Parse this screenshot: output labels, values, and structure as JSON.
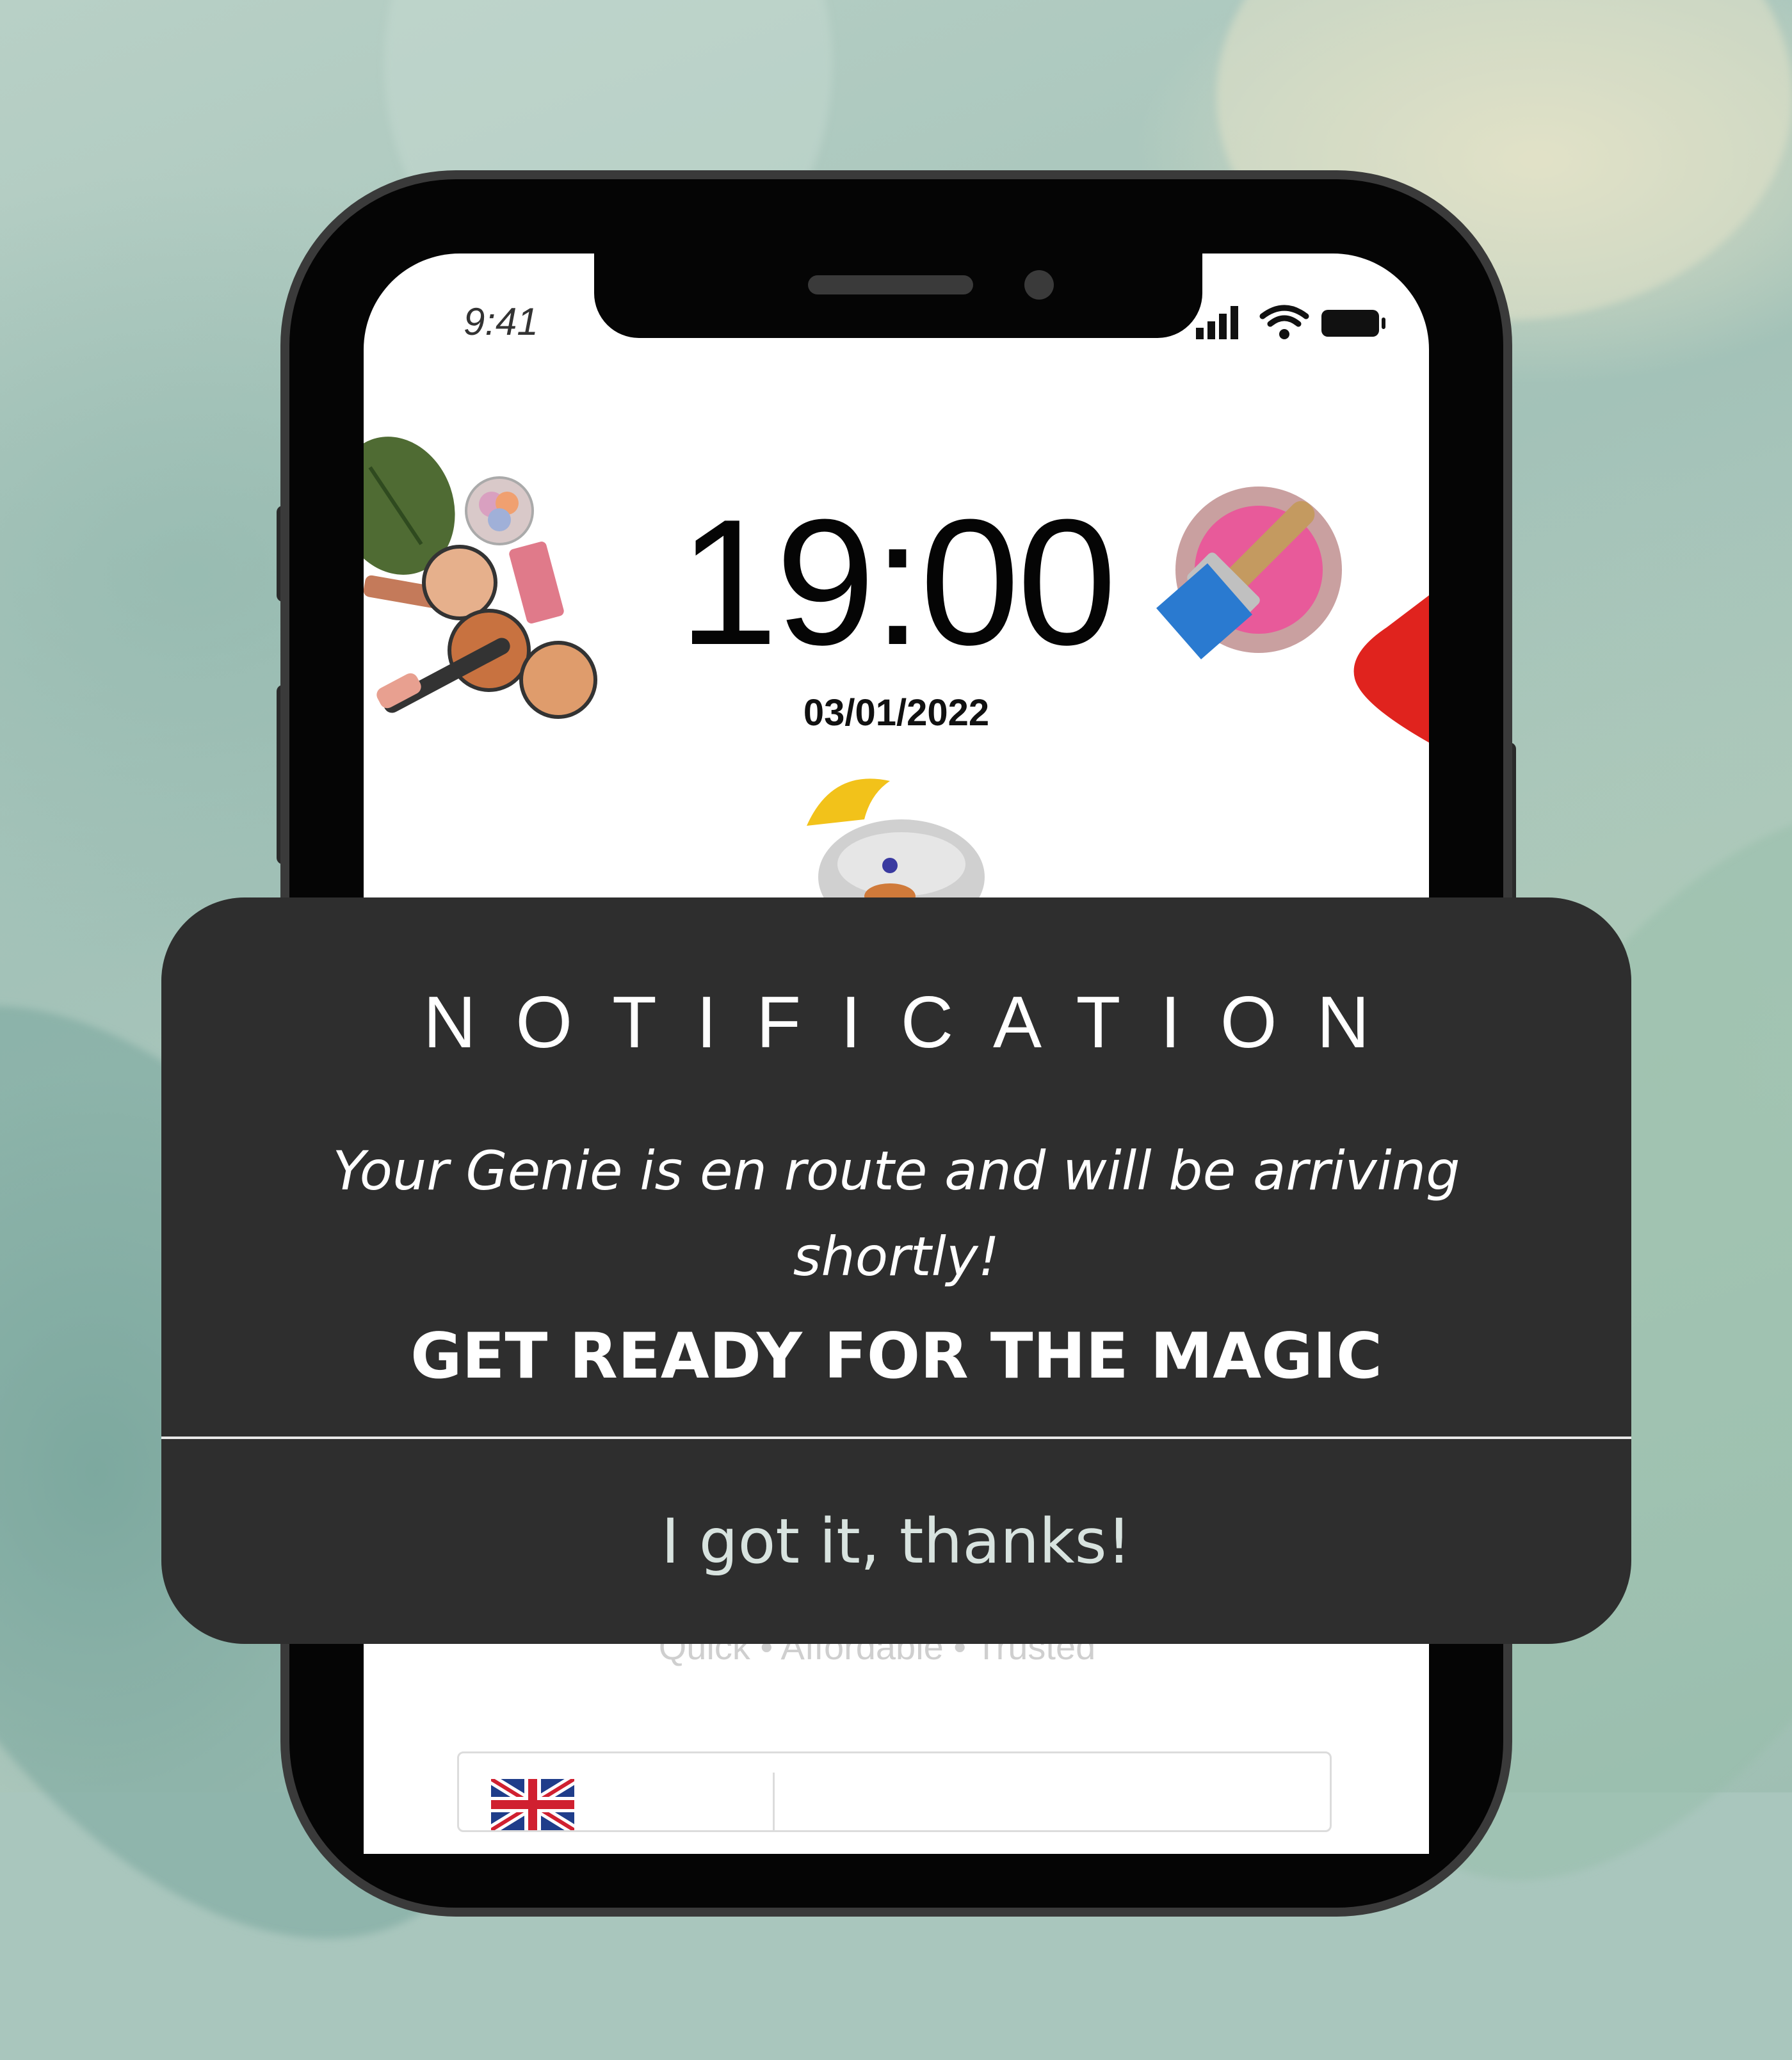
{
  "status_bar": {
    "time": "9:41"
  },
  "lock_screen": {
    "clock": "19:00",
    "date": "03/01/2022"
  },
  "background_tagline": "Quick • Affordable • Trusted",
  "notification": {
    "title": "NOTIFICATION",
    "body": "Your Genie is en route and will be arriving shortly!",
    "cta": "GET READY FOR THE MAGIC",
    "button_label": "I got it, thanks!"
  },
  "colors": {
    "card_background": "#2e2e2e",
    "text": "#ffffff",
    "button_text": "#d8e3df",
    "backdrop": "#a9c6bd"
  },
  "icons": [
    "makeup-palette-icon",
    "paint-brush-icon",
    "red-paint-stroke",
    "genie-turban-icon",
    "uk-flag-icon",
    "signal-icon",
    "wifi-icon",
    "battery-icon"
  ]
}
